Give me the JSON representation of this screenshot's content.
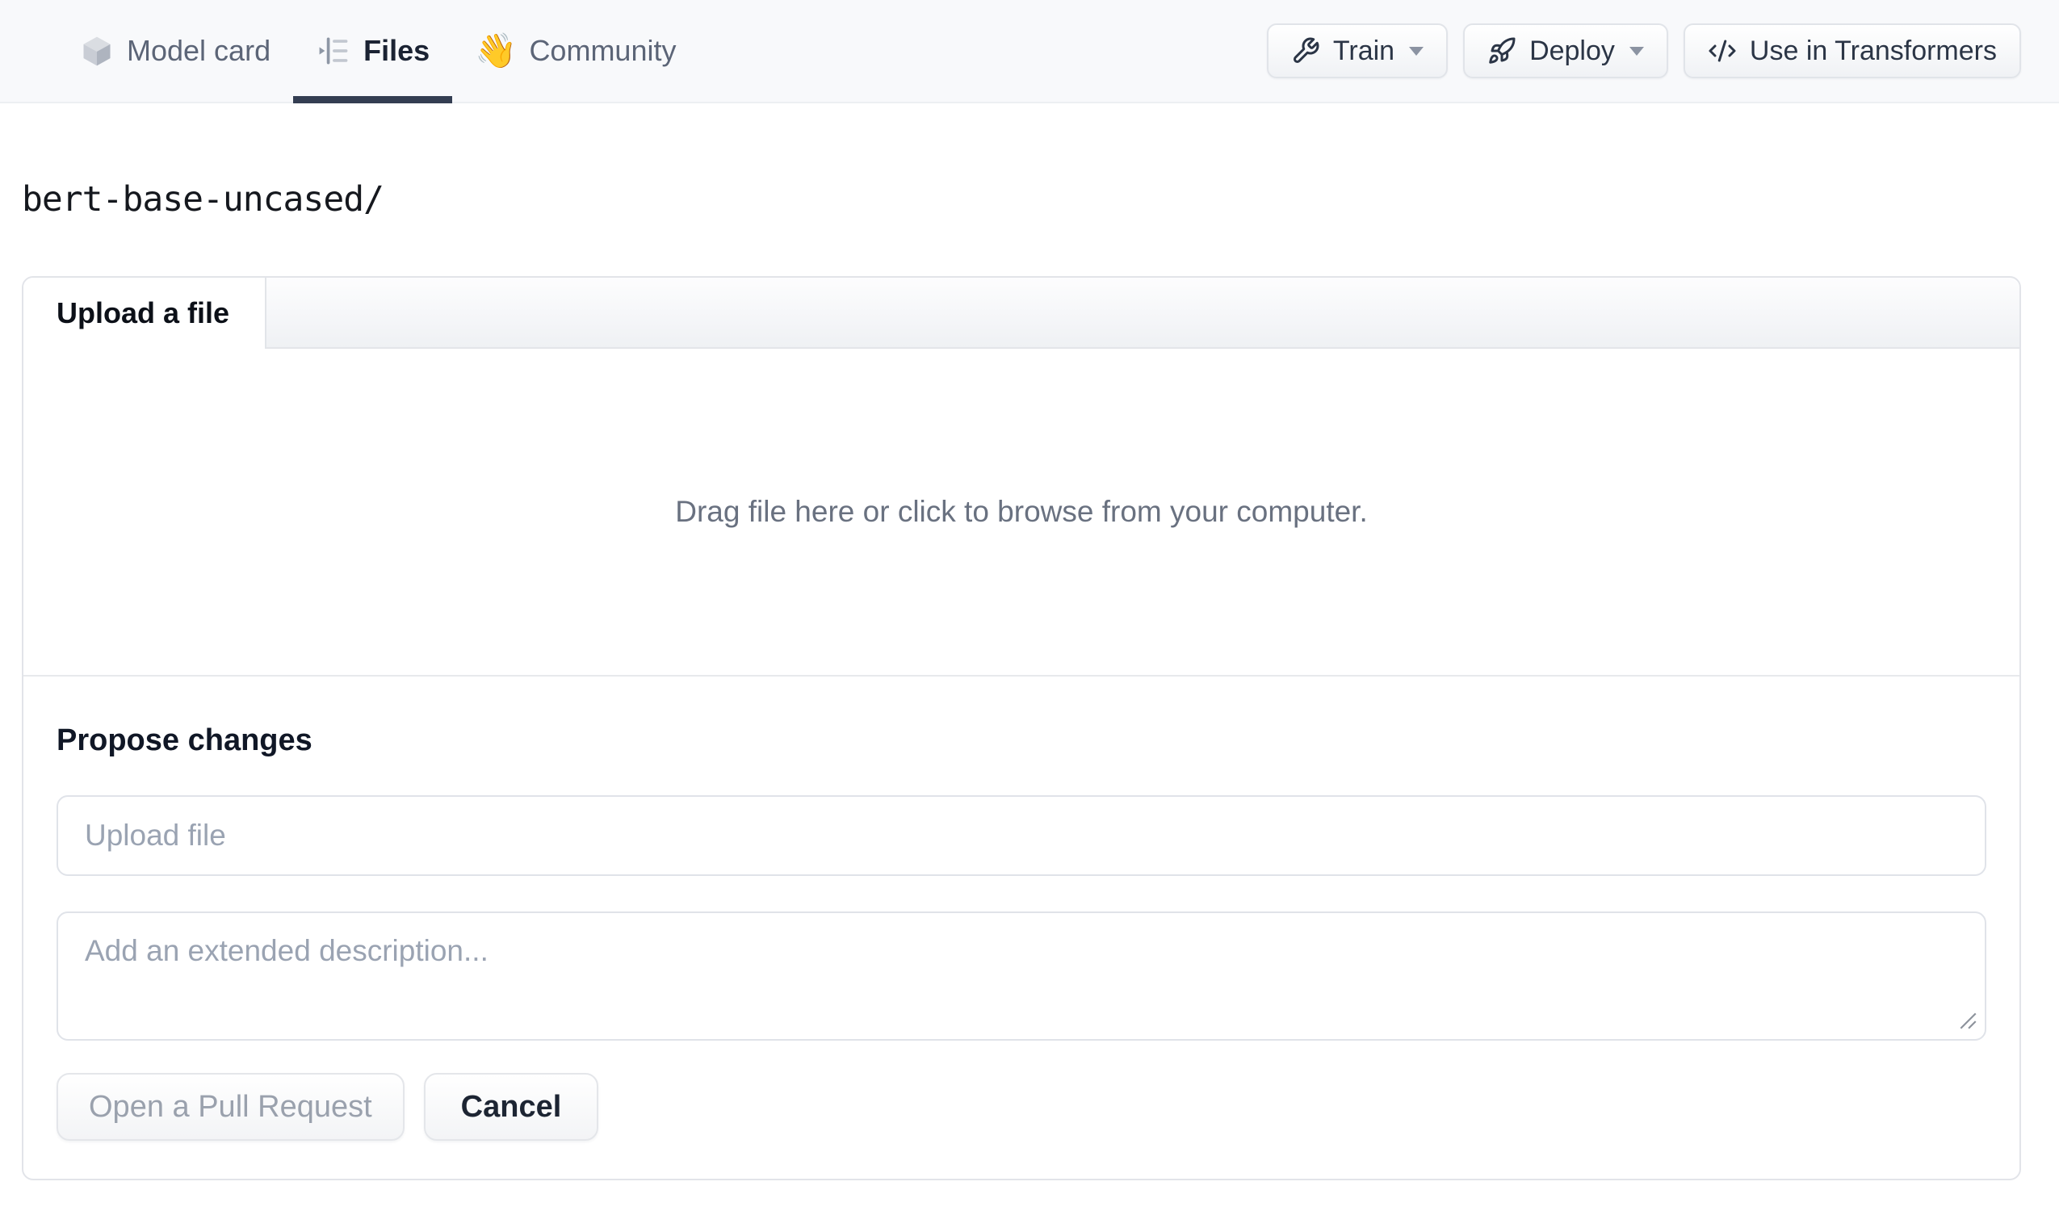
{
  "nav": {
    "tabs": {
      "model_card": {
        "label": "Model card"
      },
      "files": {
        "label": "Files"
      },
      "community": {
        "label": "Community",
        "emoji": "👋"
      }
    },
    "actions": {
      "train": {
        "label": "Train"
      },
      "deploy": {
        "label": "Deploy"
      },
      "use_in_transformers": {
        "label": "Use in Transformers"
      }
    }
  },
  "breadcrumb": {
    "path": "bert-base-uncased/"
  },
  "panel": {
    "tab_label": "Upload a file",
    "dropzone_text": "Drag file here or click to browse from your computer.",
    "propose_heading": "Propose changes",
    "file_name_placeholder": "Upload file",
    "description_placeholder": "Add an extended description...",
    "open_pr_label": "Open a Pull Request",
    "cancel_label": "Cancel"
  },
  "colors": {
    "nav_background": "#f8f9fb",
    "active_tab_underline": "#343e52",
    "active_tab_text": "#1b2333",
    "inactive_tab_text": "#5c6577",
    "button_text": "#2b3546",
    "muted_text": "#697180",
    "placeholder_text": "#9aa3b2",
    "disabled_button_text": "#9aa1ad",
    "border": "#e2e4e9"
  }
}
